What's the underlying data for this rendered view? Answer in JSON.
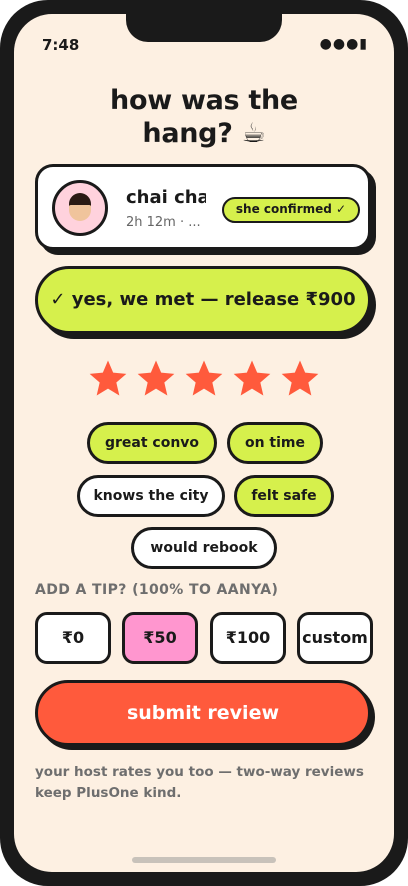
{
  "status_bar": {
    "time": "7:48",
    "icons": "●●●▮"
  },
  "title": {
    "line1": "how was the",
    "line2": "hang? ☕"
  },
  "host": {
    "name": "chai cha",
    "meta": "2h 12m · ...",
    "confirm_label": "she confirmed ✓"
  },
  "release_button": "✓ yes, we met — release ₹900",
  "rating": {
    "stars": 5,
    "max": 5,
    "color": "#ff5a3c"
  },
  "tags": [
    {
      "label": "great convo",
      "selected": true
    },
    {
      "label": "on time",
      "selected": true
    },
    {
      "label": "knows the city",
      "selected": false
    },
    {
      "label": "felt safe",
      "selected": true
    },
    {
      "label": "would rebook",
      "selected": false
    }
  ],
  "tip": {
    "heading": "ADD A TIP? (100% TO AANYA)",
    "options": [
      "₹0",
      "₹50",
      "₹100",
      "custom"
    ],
    "selected": "₹50"
  },
  "submit_button": "submit review",
  "footnote": "your host rates you too — two-way reviews keep PlusOne kind.",
  "colors": {
    "background": "#fdf0e2",
    "lime": "#d6f04c",
    "pink": "#ff96cf",
    "coral": "#ff5a3c",
    "ink": "#1a1a1a"
  }
}
